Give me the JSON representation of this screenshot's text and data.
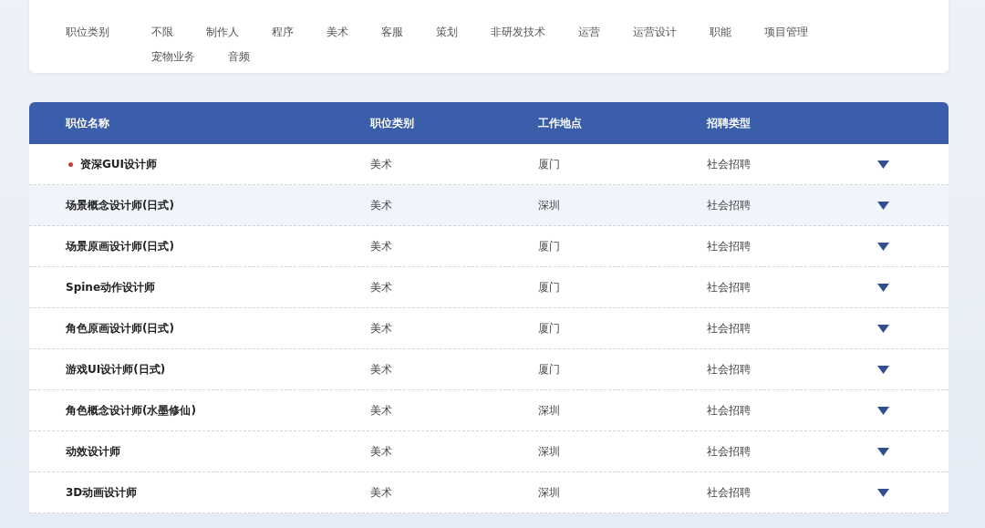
{
  "filter": {
    "label": "职位类别",
    "options": [
      {
        "text": "不限"
      },
      {
        "text": "制作人"
      },
      {
        "text": "程序"
      },
      {
        "text": "美术"
      },
      {
        "text": "客服"
      },
      {
        "text": "策划"
      },
      {
        "text": "非研发技术"
      },
      {
        "text": "运营"
      },
      {
        "text": "运营设计"
      },
      {
        "text": "职能"
      },
      {
        "text": "项目管理"
      },
      {
        "text": "宠物业务"
      },
      {
        "text": "音频"
      }
    ]
  },
  "table": {
    "columns": [
      "职位名称",
      "职位类别",
      "工作地点",
      "招聘类型"
    ],
    "rows": [
      {
        "name": "资深GUI设计师",
        "hot": true,
        "highlighted": false,
        "category": "美术",
        "location": "厦门",
        "type": "社会招聘"
      },
      {
        "name": "场景概念设计师(日式)",
        "hot": false,
        "highlighted": true,
        "category": "美术",
        "location": "深圳",
        "type": "社会招聘"
      },
      {
        "name": "场景原画设计师(日式)",
        "hot": false,
        "highlighted": false,
        "category": "美术",
        "location": "厦门",
        "type": "社会招聘"
      },
      {
        "name": "Spine动作设计师",
        "hot": false,
        "highlighted": false,
        "category": "美术",
        "location": "厦门",
        "type": "社会招聘"
      },
      {
        "name": "角色原画设计师(日式)",
        "hot": false,
        "highlighted": false,
        "category": "美术",
        "location": "厦门",
        "type": "社会招聘"
      },
      {
        "name": "游戏UI设计师(日式)",
        "hot": false,
        "highlighted": false,
        "category": "美术",
        "location": "厦门",
        "type": "社会招聘"
      },
      {
        "name": "角色概念设计师(水墨修仙)",
        "hot": false,
        "highlighted": false,
        "category": "美术",
        "location": "深圳",
        "type": "社会招聘"
      },
      {
        "name": "动效设计师",
        "hot": false,
        "highlighted": false,
        "category": "美术",
        "location": "深圳",
        "type": "社会招聘"
      },
      {
        "name": "3D动画设计师",
        "hot": false,
        "highlighted": false,
        "category": "美术",
        "location": "深圳",
        "type": "社会招聘"
      }
    ]
  }
}
